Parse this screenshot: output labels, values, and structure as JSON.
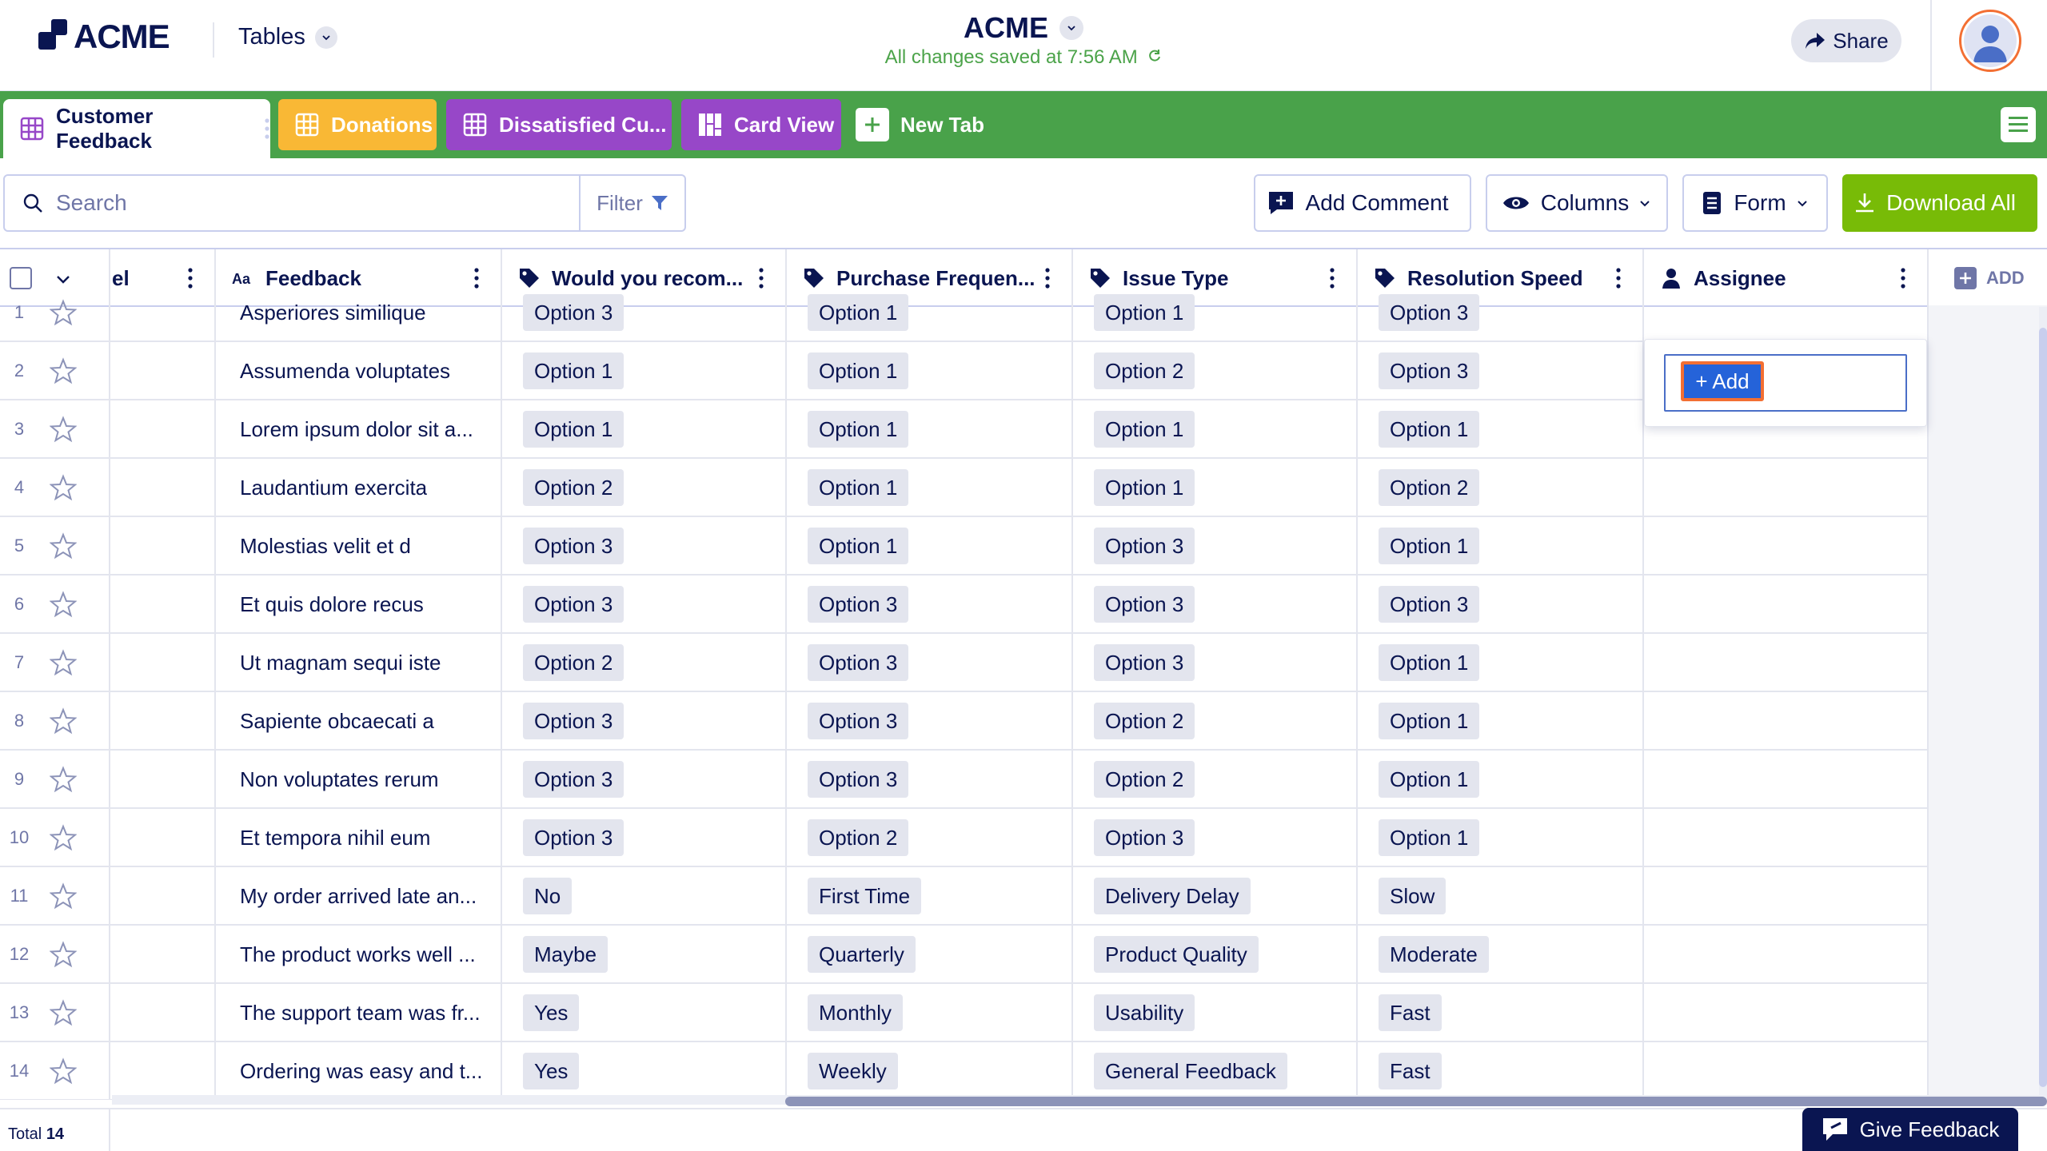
{
  "header": {
    "logo_text": "ACME",
    "tables_label": "Tables",
    "app_title": "ACME",
    "saved_status": "All changes saved at 7:56 AM",
    "share_label": "Share"
  },
  "tabs": [
    {
      "label": "Customer Feedback",
      "color": "#ffffff"
    },
    {
      "label": "Donations",
      "color": "#f9b835"
    },
    {
      "label": "Dissatisfied Cu...",
      "color": "#9747c8"
    },
    {
      "label": "Card View",
      "color": "#9747c8"
    },
    {
      "label": "New Tab",
      "color": "#49a24a"
    }
  ],
  "toolbar": {
    "search_placeholder": "Search",
    "filter_label": "Filter",
    "add_comment_label": "Add Comment",
    "columns_label": "Columns",
    "form_label": "Form",
    "download_label": "Download All"
  },
  "columns": [
    {
      "label": "el"
    },
    {
      "label": "Feedback",
      "icon": "text-type-icon"
    },
    {
      "label": "Would you recom...",
      "icon": "tag-icon"
    },
    {
      "label": "Purchase Frequen...",
      "icon": "tag-icon"
    },
    {
      "label": "Issue Type",
      "icon": "tag-icon"
    },
    {
      "label": "Resolution Speed",
      "icon": "tag-icon"
    },
    {
      "label": "Assignee",
      "icon": "person-icon"
    }
  ],
  "add_column_label": "ADD",
  "rows": [
    {
      "n": "1",
      "feedback": "Asperiores similique",
      "recommend": "Option 3",
      "frequency": "Option 1",
      "issue": "Option 1",
      "speed": "Option 3"
    },
    {
      "n": "2",
      "feedback": "Assumenda voluptates",
      "recommend": "Option 1",
      "frequency": "Option 1",
      "issue": "Option 2",
      "speed": "Option 3"
    },
    {
      "n": "3",
      "feedback": "Lorem ipsum dolor sit a...",
      "recommend": "Option 1",
      "frequency": "Option 1",
      "issue": "Option 1",
      "speed": "Option 1"
    },
    {
      "n": "4",
      "feedback": "Laudantium exercita",
      "recommend": "Option 2",
      "frequency": "Option 1",
      "issue": "Option 1",
      "speed": "Option 2"
    },
    {
      "n": "5",
      "feedback": "Molestias velit et d",
      "recommend": "Option 3",
      "frequency": "Option 1",
      "issue": "Option 3",
      "speed": "Option 1"
    },
    {
      "n": "6",
      "feedback": "Et quis dolore recus",
      "recommend": "Option 3",
      "frequency": "Option 3",
      "issue": "Option 3",
      "speed": "Option 3"
    },
    {
      "n": "7",
      "feedback": "Ut magnam sequi iste",
      "recommend": "Option 2",
      "frequency": "Option 3",
      "issue": "Option 3",
      "speed": "Option 1"
    },
    {
      "n": "8",
      "feedback": "Sapiente obcaecati a",
      "recommend": "Option 3",
      "frequency": "Option 3",
      "issue": "Option 2",
      "speed": "Option 1"
    },
    {
      "n": "9",
      "feedback": "Non voluptates rerum",
      "recommend": "Option 3",
      "frequency": "Option 3",
      "issue": "Option 2",
      "speed": "Option 1"
    },
    {
      "n": "10",
      "feedback": "Et tempora nihil eum",
      "recommend": "Option 3",
      "frequency": "Option 2",
      "issue": "Option 3",
      "speed": "Option 1"
    },
    {
      "n": "11",
      "feedback": "My order arrived late an...",
      "recommend": "No",
      "frequency": "First Time",
      "issue": "Delivery Delay",
      "speed": "Slow"
    },
    {
      "n": "12",
      "feedback": "The product works well ...",
      "recommend": "Maybe",
      "frequency": "Quarterly",
      "issue": "Product Quality",
      "speed": "Moderate"
    },
    {
      "n": "13",
      "feedback": "The support team was fr...",
      "recommend": "Yes",
      "frequency": "Monthly",
      "issue": "Usability",
      "speed": "Fast"
    },
    {
      "n": "14",
      "feedback": "Ordering was easy and t...",
      "recommend": "Yes",
      "frequency": "Weekly",
      "issue": "General Feedback",
      "speed": "Fast"
    }
  ],
  "assignee_popover": {
    "add_label": "+ Add"
  },
  "footer": {
    "total_label": "Total",
    "total_count": "14",
    "give_feedback_label": "Give Feedback"
  },
  "colors": {
    "navy": "#0a1551",
    "green_bar": "#49a24a",
    "download_green": "#78bb07",
    "orange": "#f36f33",
    "blue": "#2563d9"
  }
}
